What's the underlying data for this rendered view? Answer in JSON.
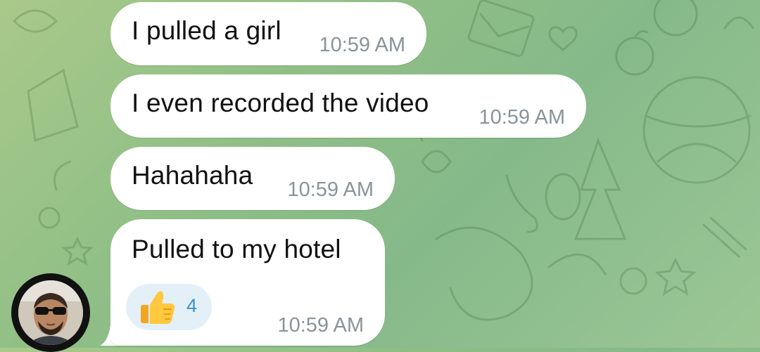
{
  "chat": {
    "messages": [
      {
        "text": "I pulled a girl",
        "time": "10:59 AM"
      },
      {
        "text": "I even recorded the video",
        "time": "10:59 AM"
      },
      {
        "text": "Hahahaha",
        "time": "10:59 AM"
      },
      {
        "text": "Pulled to my hotel",
        "time": "10:59 AM",
        "reaction": {
          "emoji": "thumbs-up",
          "count": "4"
        }
      }
    ]
  },
  "sender": {
    "avatar": "person-with-sunglasses"
  },
  "colors": {
    "bubble": "#ffffff",
    "timestamp": "#8a939a",
    "reaction_bg": "#e4f0f8",
    "reaction_count": "#3f8fc9",
    "wallpaper": "#8fbf86"
  }
}
